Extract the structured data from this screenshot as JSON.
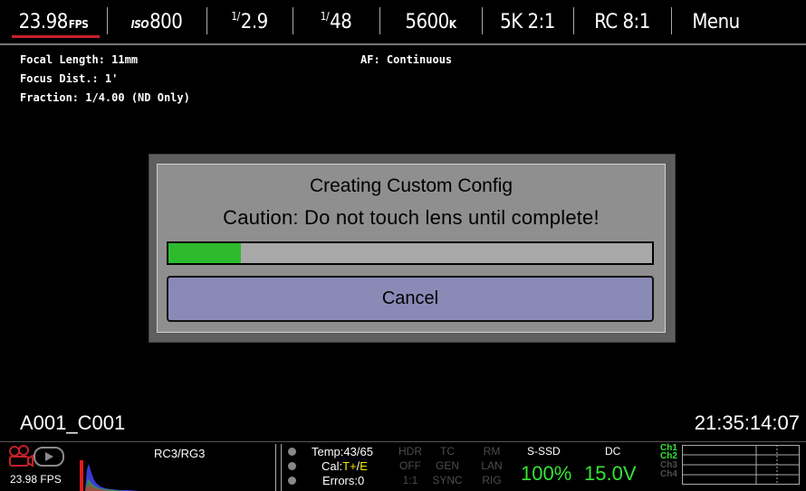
{
  "topbar": {
    "fps_value": "23.98",
    "fps_unit": "FPS",
    "iso_prefix": "ISO",
    "iso_value": "800",
    "aperture_frac": "1/",
    "aperture_value": "2.9",
    "shutter_frac": "1/",
    "shutter_value": "48",
    "kelvin_value": "5600",
    "kelvin_unit": "K",
    "format": "5K 2:1",
    "compression": "RC 8:1",
    "menu": "Menu"
  },
  "lens_info": {
    "focal_length": "Focal Length: 11mm",
    "focus_dist": "Focus Dist.: 1'",
    "fraction": "Fraction: 1/4.00 (ND Only)",
    "af_mode": "AF: Continuous"
  },
  "dialog": {
    "title": "Creating Custom Config",
    "message": "Caution: Do not touch lens until complete!",
    "progress_fraction": 0.15,
    "cancel_label": "Cancel"
  },
  "clip": {
    "name": "A001_C001",
    "timecode": "21:35:14:07"
  },
  "bottombar": {
    "fps": "23.98 FPS",
    "histogram_title": "RC3/RG3",
    "temp": "Temp:43/65",
    "cal_prefix": "Cal:",
    "cal_t": "T+",
    "cal_sep": "/",
    "cal_e": "E",
    "errors": "Errors:0",
    "hdr_top": "HDR",
    "hdr_bottom": "OFF",
    "ratio": "1:1",
    "tc_top": "TC",
    "tc_mid": "GEN",
    "tc_bottom": "SYNC",
    "rm_top": "RM",
    "rm_mid": "LAN",
    "rm_bottom": "RIG",
    "media_label": "S-SSD",
    "media_value": "100%",
    "power_label": "DC",
    "power_value": "15.0V",
    "ch1": "Ch1",
    "ch2": "Ch2",
    "ch3": "Ch3",
    "ch4": "Ch4"
  },
  "colors": {
    "accent_red": "#c8202a",
    "progress_green": "#2dbb2d",
    "status_green": "#35e435",
    "cancel_blue": "#8a8ab6"
  }
}
